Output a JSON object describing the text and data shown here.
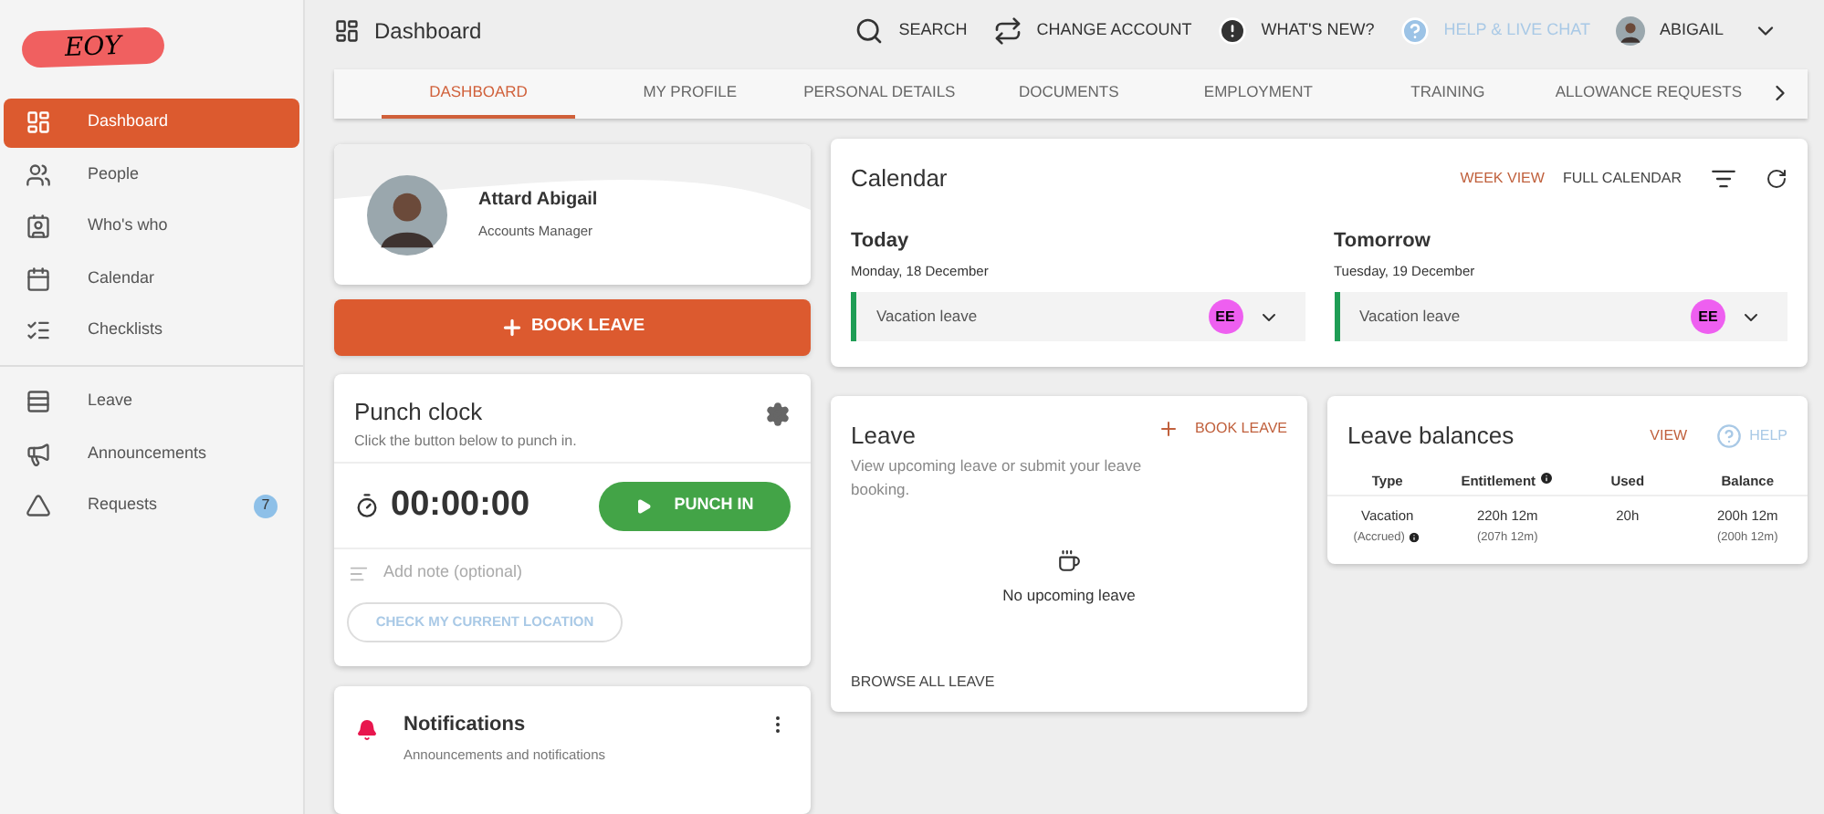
{
  "logo": {
    "text": "EOY"
  },
  "sidebar": {
    "sections": [
      {
        "items": [
          {
            "label": "Dashboard",
            "selected": true
          },
          {
            "label": "People",
            "selected": false
          },
          {
            "label": "Who's who",
            "selected": false
          },
          {
            "label": "Calendar",
            "selected": false
          },
          {
            "label": "Checklists",
            "selected": false
          }
        ]
      },
      {
        "items": [
          {
            "label": "Leave",
            "selected": false
          },
          {
            "label": "Announcements",
            "selected": false
          },
          {
            "label": "Requests",
            "selected": false,
            "badge": "7"
          }
        ]
      }
    ]
  },
  "header": {
    "title": "Dashboard",
    "actions": [
      {
        "label": "SEARCH",
        "kind": "search"
      },
      {
        "label": "CHANGE ACCOUNT",
        "kind": "switch"
      },
      {
        "label": "WHAT'S NEW?",
        "kind": "news"
      },
      {
        "label": "HELP & LIVE CHAT",
        "kind": "help"
      },
      {
        "label": "ABIGAIL",
        "kind": "user"
      }
    ]
  },
  "tabs": [
    {
      "label": "DASHBOARD",
      "selected": true
    },
    {
      "label": "MY PROFILE",
      "selected": false
    },
    {
      "label": "PERSONAL DETAILS",
      "selected": false
    },
    {
      "label": "DOCUMENTS",
      "selected": false
    },
    {
      "label": "EMPLOYMENT",
      "selected": false
    },
    {
      "label": "TRAINING",
      "selected": false
    },
    {
      "label": "ALLOWANCE REQUESTS",
      "selected": false
    }
  ],
  "profile": {
    "name": "Attard Abigail",
    "role": "Accounts Manager"
  },
  "book_leave_button": "BOOK LEAVE",
  "punch_clock": {
    "title": "Punch clock",
    "subtitle": "Click the button below to punch in.",
    "timer": "00:00:00",
    "button": "PUNCH IN",
    "note_placeholder": "Add note (optional)",
    "location_button": "CHECK MY CURRENT LOCATION"
  },
  "notifications": {
    "title": "Notifications",
    "subtitle": "Announcements and notifications"
  },
  "calendar": {
    "title": "Calendar",
    "links": [
      {
        "label": "WEEK VIEW",
        "selected": true
      },
      {
        "label": "FULL CALENDAR",
        "selected": false
      }
    ],
    "days": [
      {
        "title": "Today",
        "date": "Monday, 18 December",
        "entries": [
          {
            "label": "Vacation leave",
            "initials": "EE",
            "color": "#ee5ff0"
          }
        ]
      },
      {
        "title": "Tomorrow",
        "date": "Tuesday, 19 December",
        "entries": [
          {
            "label": "Vacation leave",
            "initials": "EE",
            "color": "#ee5ff0"
          }
        ]
      }
    ]
  },
  "leave": {
    "title": "Leave",
    "action": "BOOK LEAVE",
    "description": "View upcoming leave or submit your leave booking.",
    "empty": "No upcoming leave",
    "footer": "BROWSE ALL LEAVE"
  },
  "leave_balances": {
    "title": "Leave balances",
    "view": "VIEW",
    "help": "HELP",
    "columns": [
      {
        "label": "Type"
      },
      {
        "label": "Entitlement",
        "info": true
      },
      {
        "label": "Used"
      },
      {
        "label": "Balance"
      }
    ],
    "rows": [
      {
        "cells": [
          {
            "main": "Vacation",
            "sub": "(Accrued)",
            "info": true
          },
          {
            "main": "220h 12m",
            "sub": "(207h 12m)"
          },
          {
            "main": "20h"
          },
          {
            "main": "200h 12m",
            "sub": "(200h 12m)"
          }
        ]
      }
    ]
  }
}
